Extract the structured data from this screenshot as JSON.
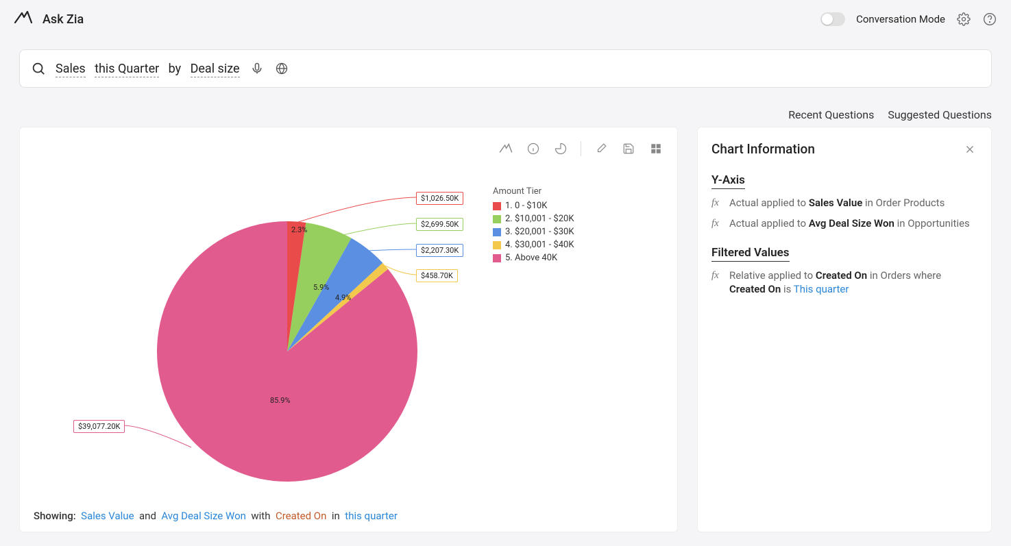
{
  "header": {
    "title": "Ask Zia",
    "conversation_mode_label": "Conversation Mode"
  },
  "search": {
    "raw_query": "Sales this Quarter by Deal size",
    "token_sales": "Sales",
    "token_this_quarter": "this Quarter",
    "token_by": "by",
    "token_deal_size": "Deal size"
  },
  "subnav": {
    "recent": "Recent Questions",
    "suggested": "Suggested Questions"
  },
  "chart_data": {
    "type": "pie",
    "legend_title": "Amount Tier",
    "series": [
      {
        "name": "1. 0 - $10K",
        "percent": 2.3,
        "value_label": "$1,026.50K",
        "color": "#e94b4b"
      },
      {
        "name": "2. $10,001 - $20K",
        "percent": 5.9,
        "value_label": "$2,699.50K",
        "color": "#97cf5e"
      },
      {
        "name": "3. $20,001 - $30K",
        "percent": 4.9,
        "value_label": "$2,207.30K",
        "color": "#5a8fe2"
      },
      {
        "name": "4. $30,001 - $40K",
        "percent": 1.0,
        "value_label": "$458.70K",
        "color": "#f2c94c"
      },
      {
        "name": "5. Above 40K",
        "percent": 85.9,
        "value_label": "$39,077.20K",
        "color": "#e15b8e"
      }
    ]
  },
  "showing": {
    "prefix": "Showing:",
    "sales_value": "Sales Value",
    "and": "and",
    "avg_deal": "Avg Deal Size Won",
    "with": "with",
    "created_on": "Created On",
    "in": "in",
    "this_quarter": "this quarter"
  },
  "sidepanel": {
    "title": "Chart Information",
    "yaxis_heading": "Y-Axis",
    "yaxis_rows": [
      {
        "fn": "Actual",
        "applied_to": "applied to",
        "field": "Sales Value",
        "in": "in",
        "table": "Order Products"
      },
      {
        "fn": "Actual",
        "applied_to": "applied to",
        "field": "Avg Deal Size Won",
        "in": "in",
        "table": "Opportunities"
      }
    ],
    "filters_heading": "Filtered Values",
    "filter_row": {
      "fn": "Relative",
      "applied_to": "applied to",
      "field": "Created On",
      "in": "in",
      "table": "Orders",
      "where": "where",
      "field2": "Created On",
      "is": "is",
      "value": "This quarter"
    }
  }
}
